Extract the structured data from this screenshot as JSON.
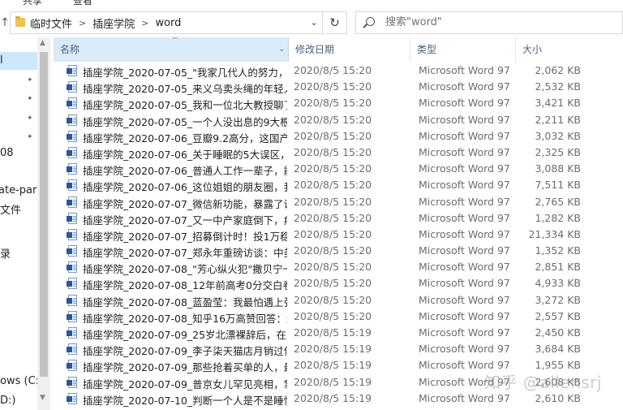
{
  "ribbon": {
    "tabs": [
      "共享",
      "查看"
    ]
  },
  "address": {
    "up_arrow": "↑",
    "crumbs": [
      "临时文件",
      "插座学院",
      "word"
    ],
    "dropdown": "⌄",
    "refresh": "↻"
  },
  "search": {
    "placeholder": "搜索\"word\""
  },
  "nav": {
    "items": [
      "l",
      "",
      "",
      "",
      "",
      "08",
      "",
      "ate-parts",
      "文件",
      "",
      "",
      "录",
      "",
      "",
      "",
      "",
      "ows (C:)",
      "D:)"
    ]
  },
  "columns": {
    "name": "名称",
    "date": "修改日期",
    "type": "类型",
    "size": "大小"
  },
  "files": [
    {
      "name": "插座学院_2020-07-05_\"我家几代人的努力，...",
      "date": "2020/8/5 15:20",
      "type": "Microsoft Word 97 ...",
      "size": "2,062 KB"
    },
    {
      "name": "插座学院_2020-07-05_来义乌卖头绳的年轻人...",
      "date": "2020/8/5 15:20",
      "type": "Microsoft Word 97 ...",
      "size": "2,532 KB"
    },
    {
      "name": "插座学院_2020-07-05_我和一位北大教授聊了...",
      "date": "2020/8/5 15:20",
      "type": "Microsoft Word 97 ...",
      "size": "3,421 KB"
    },
    {
      "name": "插座学院_2020-07-05_一个人没出息的9大根...",
      "date": "2020/8/5 15:20",
      "type": "Microsoft Word 97 ...",
      "size": "2,211 KB"
    },
    {
      "name": "插座学院_2020-07-06_豆瓣9.2高分，这国产...",
      "date": "2020/8/5 15:20",
      "type": "Microsoft Word 97 ...",
      "size": "3,032 KB"
    },
    {
      "name": "插座学院_2020-07-06_关于睡眠的5大误区，...",
      "date": "2020/8/5 15:20",
      "type": "Microsoft Word 97 ...",
      "size": "2,325 KB"
    },
    {
      "name": "插座学院_2020-07-06_普通人工作一辈子，能...",
      "date": "2020/8/5 15:20",
      "type": "Microsoft Word 97 ...",
      "size": "3,088 KB"
    },
    {
      "name": "插座学院_2020-07-06_这位姐姐的朋友圈，我...",
      "date": "2020/8/5 15:20",
      "type": "Microsoft Word 97 ...",
      "size": "7,511 KB"
    },
    {
      "name": "插座学院_2020-07-07_微信新功能，暴露了谁...",
      "date": "2020/8/5 15:20",
      "type": "Microsoft Word 97 ...",
      "size": "2,765 KB"
    },
    {
      "name": "插座学院_2020-07-07_又一中产家庭倒下，病...",
      "date": "2020/8/5 15:20",
      "type": "Microsoft Word 97 ...",
      "size": "1,282 KB"
    },
    {
      "name": "插座学院_2020-07-07_招募倒计时！投1万稳...",
      "date": "2020/8/5 15:20",
      "type": "Microsoft Word 97 ...",
      "size": "21,334 KB"
    },
    {
      "name": "插座学院_2020-07-07_郑永年重磅访谈：中美...",
      "date": "2020/8/5 15:20",
      "type": "Microsoft Word 97 ...",
      "size": "1,352 KB"
    },
    {
      "name": "插座学院_2020-07-08_\"芳心纵火犯\"撒贝宁一...",
      "date": "2020/8/5 15:20",
      "type": "Microsoft Word 97 ...",
      "size": "2,851 KB"
    },
    {
      "name": "插座学院_2020-07-08_12年前高考0分交白卷...",
      "date": "2020/8/5 15:20",
      "type": "Microsoft Word 97 ...",
      "size": "4,933 KB"
    },
    {
      "name": "插座学院_2020-07-08_蓝盈莹：我最怕遇上张...",
      "date": "2020/8/5 15:20",
      "type": "Microsoft Word 97 ...",
      "size": "3,272 KB"
    },
    {
      "name": "插座学院_2020-07-08_知乎16万高赞回答：这...",
      "date": "2020/8/5 15:20",
      "type": "Microsoft Word 97 ...",
      "size": "2,557 KB"
    },
    {
      "name": "插座学院_2020-07-09_25岁北漂裸辞后，在家...",
      "date": "2020/8/5 15:19",
      "type": "Microsoft Word 97 ...",
      "size": "2,450 KB"
    },
    {
      "name": "插座学院_2020-07-09_李子柒天猫店月销过亿...",
      "date": "2020/8/5 15:19",
      "type": "Microsoft Word 97 ...",
      "size": "3,684 KB"
    },
    {
      "name": "插座学院_2020-07-09_那些抢着买单的人，最...",
      "date": "2020/8/5 15:19",
      "type": "Microsoft Word 97 ...",
      "size": "1,955 KB"
    },
    {
      "name": "插座学院_2020-07-09_普京女儿罕见亮相，掌...",
      "date": "2020/8/5 15:19",
      "type": "Microsoft Word 97 ...",
      "size": "2,608 KB"
    },
    {
      "name": "插座学院_2020-07-10_判断一个人是不是睡忙...",
      "date": "2020/8/5 15:19",
      "type": "Microsoft Word 97 ...",
      "size": "2,610 KB"
    }
  ],
  "watermark": "知乎 @allensrj"
}
